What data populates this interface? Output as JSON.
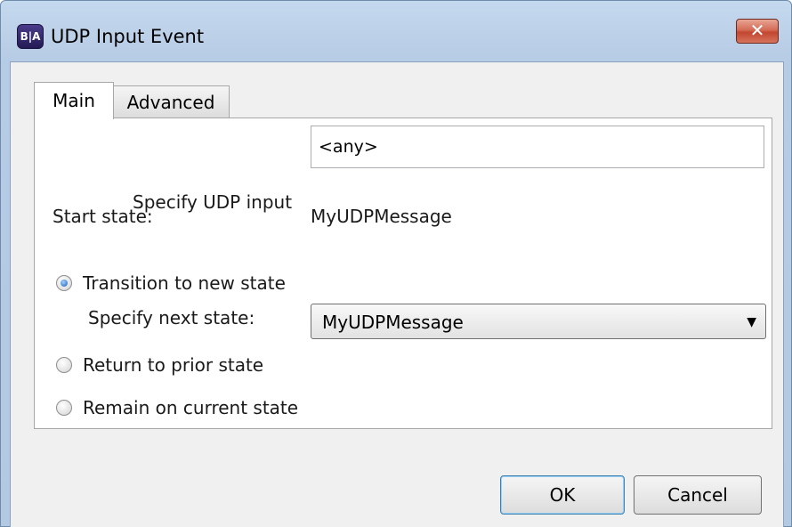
{
  "window": {
    "title": "UDP Input Event",
    "app_icon_text": "B|A",
    "close_glyph": "✕"
  },
  "tabs": [
    {
      "label": "Main",
      "active": true
    },
    {
      "label": "Advanced",
      "active": false
    }
  ],
  "form": {
    "udp_input_label": "Specify UDP input",
    "udp_input_value": "<any>",
    "start_state_label": "Start state:",
    "start_state_value": "MyUDPMessage",
    "radios": [
      {
        "label": "Transition to new state",
        "checked": true
      },
      {
        "label": "Return to prior state",
        "checked": false
      },
      {
        "label": "Remain on current state",
        "checked": false
      }
    ],
    "next_state_label": "Specify next state:",
    "next_state_value": "MyUDPMessage",
    "dropdown_arrow": "▼"
  },
  "buttons": {
    "ok": "OK",
    "cancel": "Cancel"
  },
  "colors": {
    "titlebar": "#b6cbe4",
    "close_button": "#c24630",
    "default_button_border": "#3c7fb1"
  }
}
